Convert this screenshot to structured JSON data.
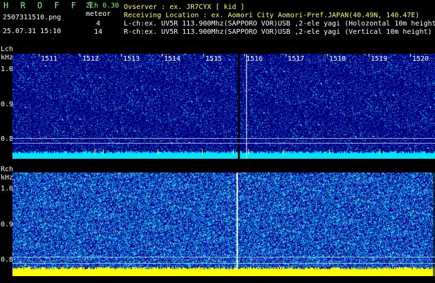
{
  "header": {
    "app_title": "H R O F F T",
    "version": "2ch 0.30",
    "filename": "2507311510.png",
    "meteor_label": "meteor",
    "lch_count": "4",
    "rch_count": "14",
    "datetime": "25.07.31 15:10",
    "info": [
      "Ovserver               : ex. JR7CYX [ kid ]",
      "Receiving Location : ex. Aomori City Aomori-Pref.JAPAN(40.49N, 140.47E)",
      "L-ch:ex. UV5R 113.900Mhz(SAPPORO VOR)USB ,2-ele yagi (Holozontal 10m height)",
      "R-ch:ex. UV5R 113.900Mhz(SAPPORO VOR)USB ,2-ele yagi (Vertical 10m height)"
    ]
  },
  "lch": {
    "label": "Lch",
    "unit": "kHz",
    "y_ticks": [
      "1.0",
      "0.9",
      "0.8"
    ],
    "time_marks": [
      "1511",
      "1512",
      "1513",
      "1514",
      "1515",
      "1516",
      "1517",
      "1518",
      "1519",
      "1520"
    ]
  },
  "rch": {
    "label": "Rch",
    "unit": "kHz",
    "y_ticks": [
      "1.0",
      "0.9",
      "0.8"
    ]
  },
  "colors": {
    "text_green": "#7cfc7c",
    "lch_floor": "#00e5ff",
    "rch_floor": "#ffff00",
    "waterfall_bg": "#00007a"
  }
}
